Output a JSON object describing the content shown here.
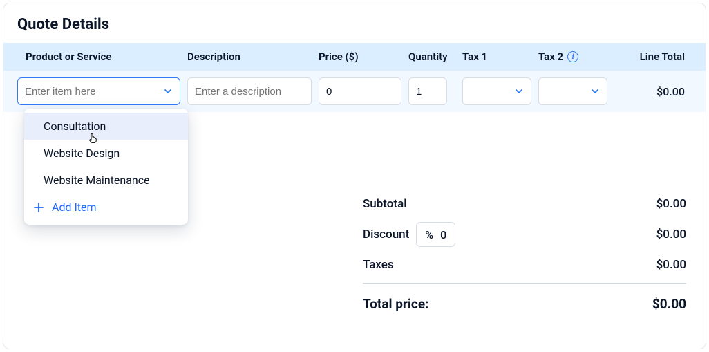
{
  "title": "Quote Details",
  "columns": {
    "product": "Product or Service",
    "description": "Description",
    "price": "Price ($)",
    "quantity": "Quantity",
    "tax1": "Tax 1",
    "tax2": "Tax 2",
    "lineTotal": "Line Total"
  },
  "row": {
    "productPlaceholder": "Enter item here",
    "descriptionPlaceholder": "Enter a description",
    "price": "0",
    "quantity": "1",
    "lineTotal": "$0.00"
  },
  "dropdown": {
    "options": [
      "Consultation",
      "Website Design",
      "Website Maintenance"
    ],
    "addItem": "Add Item"
  },
  "summary": {
    "subtotalLabel": "Subtotal",
    "subtotalValue": "$0.00",
    "discountLabel": "Discount",
    "discountSymbol": "%",
    "discountValue": "0",
    "discountAmount": "$0.00",
    "taxesLabel": "Taxes",
    "taxesValue": "$0.00",
    "totalLabel": "Total price:",
    "totalValue": "$0.00"
  }
}
